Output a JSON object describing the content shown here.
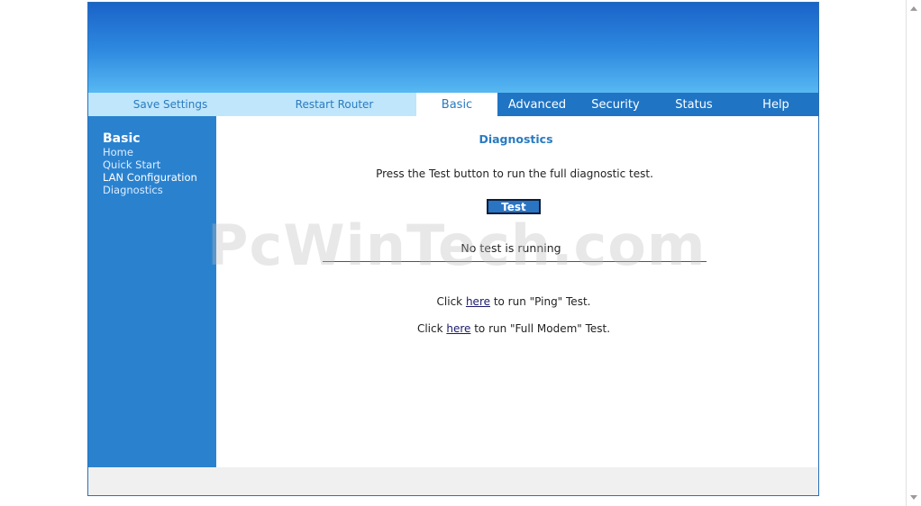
{
  "nav": {
    "save_settings": "Save Settings",
    "restart_router": "Restart Router",
    "tabs": [
      {
        "label": "Basic",
        "active": true
      },
      {
        "label": "Advanced",
        "active": false
      },
      {
        "label": "Security",
        "active": false
      },
      {
        "label": "Status",
        "active": false
      },
      {
        "label": "Help",
        "active": false
      }
    ]
  },
  "sidebar": {
    "title": "Basic",
    "items": [
      {
        "label": "Home"
      },
      {
        "label": "Quick Start"
      },
      {
        "label": "LAN Configuration"
      },
      {
        "label": "Diagnostics"
      }
    ]
  },
  "main": {
    "title": "Diagnostics",
    "instruction": "Press the Test button to run the full diagnostic test.",
    "test_button": "Test",
    "status": "No test is running",
    "ping": {
      "prefix": "Click ",
      "link": "here",
      "suffix": " to run \"Ping\" Test."
    },
    "modem": {
      "prefix": "Click ",
      "link": "here",
      "suffix": " to run \"Full Modem\" Test."
    }
  },
  "watermark": "PcWinTech.com",
  "colors": {
    "banner_top": "#1a63c8",
    "banner_bottom": "#57b8f2",
    "nav_bar": "#1f74c4",
    "nav_util": "#bfe6fb",
    "sidebar": "#2a82cf",
    "accent_text": "#2a7bc0"
  }
}
